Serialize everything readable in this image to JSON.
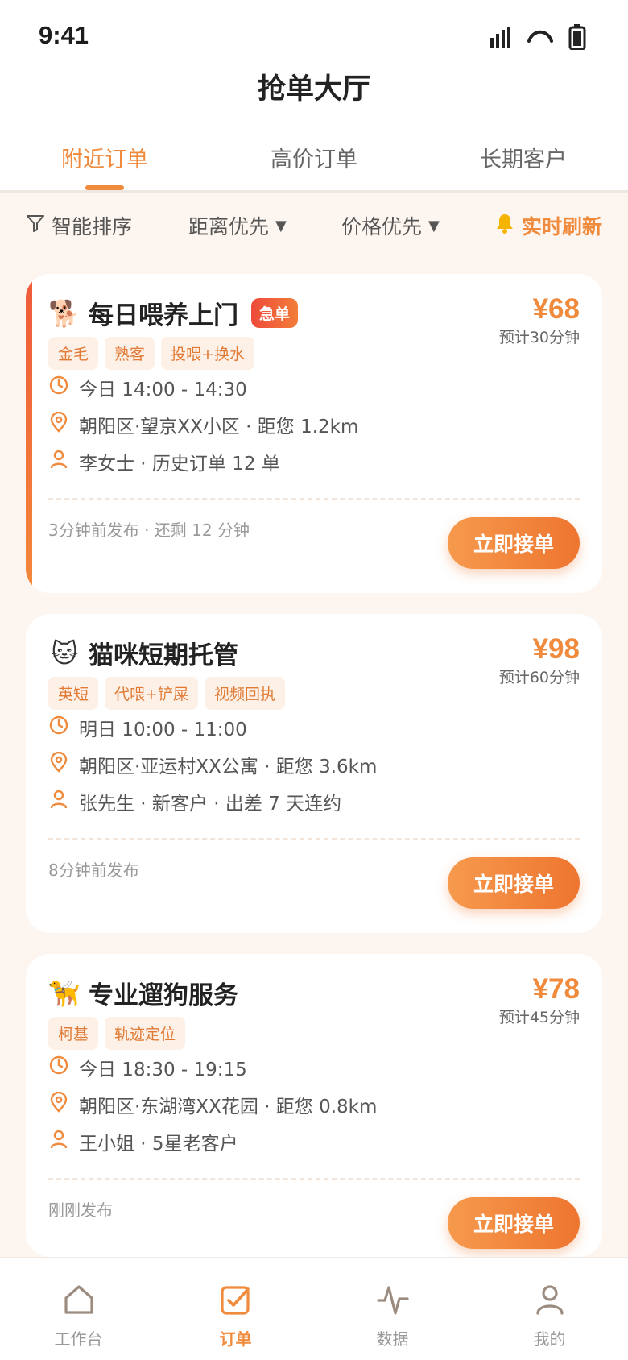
{
  "status": {
    "time": "9:41"
  },
  "header": {
    "title": "抢单大厅"
  },
  "tabs": [
    {
      "label": "附近订单",
      "active": true
    },
    {
      "label": "高价订单",
      "active": false
    },
    {
      "label": "长期客户",
      "active": false
    }
  ],
  "filters": {
    "smart_sort": "智能排序",
    "distance": "距离优先",
    "price": "价格优先",
    "refresh": "实时刷新"
  },
  "orders": [
    {
      "pet_icon": "dog-icon",
      "emoji": "🐕",
      "title": "每日喂养上门",
      "badge": "急单",
      "price": "¥68",
      "estimate": "预计30分钟",
      "tags": [
        "金毛",
        "熟客",
        "投喂+换水"
      ],
      "time": "今日 14:00 - 14:30",
      "location": "朝阳区·望京XX小区 · 距您 1.2km",
      "customer": "李女士 · 历史订单 12 单",
      "posted": "3分钟前发布 · 还剩 12 分钟",
      "action": "立即接单"
    },
    {
      "pet_icon": "cat-icon",
      "emoji": "🐱",
      "title": "猫咪短期托管",
      "badge": "",
      "price": "¥98",
      "estimate": "预计60分钟",
      "tags": [
        "英短",
        "代喂+铲屎",
        "视频回执"
      ],
      "time": "明日 10:00 - 11:00",
      "location": "朝阳区·亚运村XX公寓 · 距您 3.6km",
      "customer": "张先生 · 新客户 · 出差 7 天连约",
      "posted": "8分钟前发布",
      "action": "立即接单"
    },
    {
      "pet_icon": "guide-dog-icon",
      "emoji": "🦮",
      "title": "专业遛狗服务",
      "badge": "",
      "price": "¥78",
      "estimate": "预计45分钟",
      "tags": [
        "柯基",
        "轨迹定位"
      ],
      "time": "今日 18:30 - 19:15",
      "location": "朝阳区·东湖湾XX花园 · 距您 0.8km",
      "customer": "王小姐 · 5星老客户",
      "posted": "刚刚发布",
      "action": "立即接单"
    }
  ],
  "nav": [
    {
      "label": "工作台",
      "icon": "home-icon",
      "active": false
    },
    {
      "label": "订单",
      "icon": "order-check-icon",
      "active": true
    },
    {
      "label": "数据",
      "icon": "chart-pulse-icon",
      "active": false
    },
    {
      "label": "我的",
      "icon": "user-icon",
      "active": false
    }
  ],
  "colors": {
    "accent": "#f08a3c",
    "urgent": "#ee4a3a",
    "background": "#fdf6f0"
  }
}
